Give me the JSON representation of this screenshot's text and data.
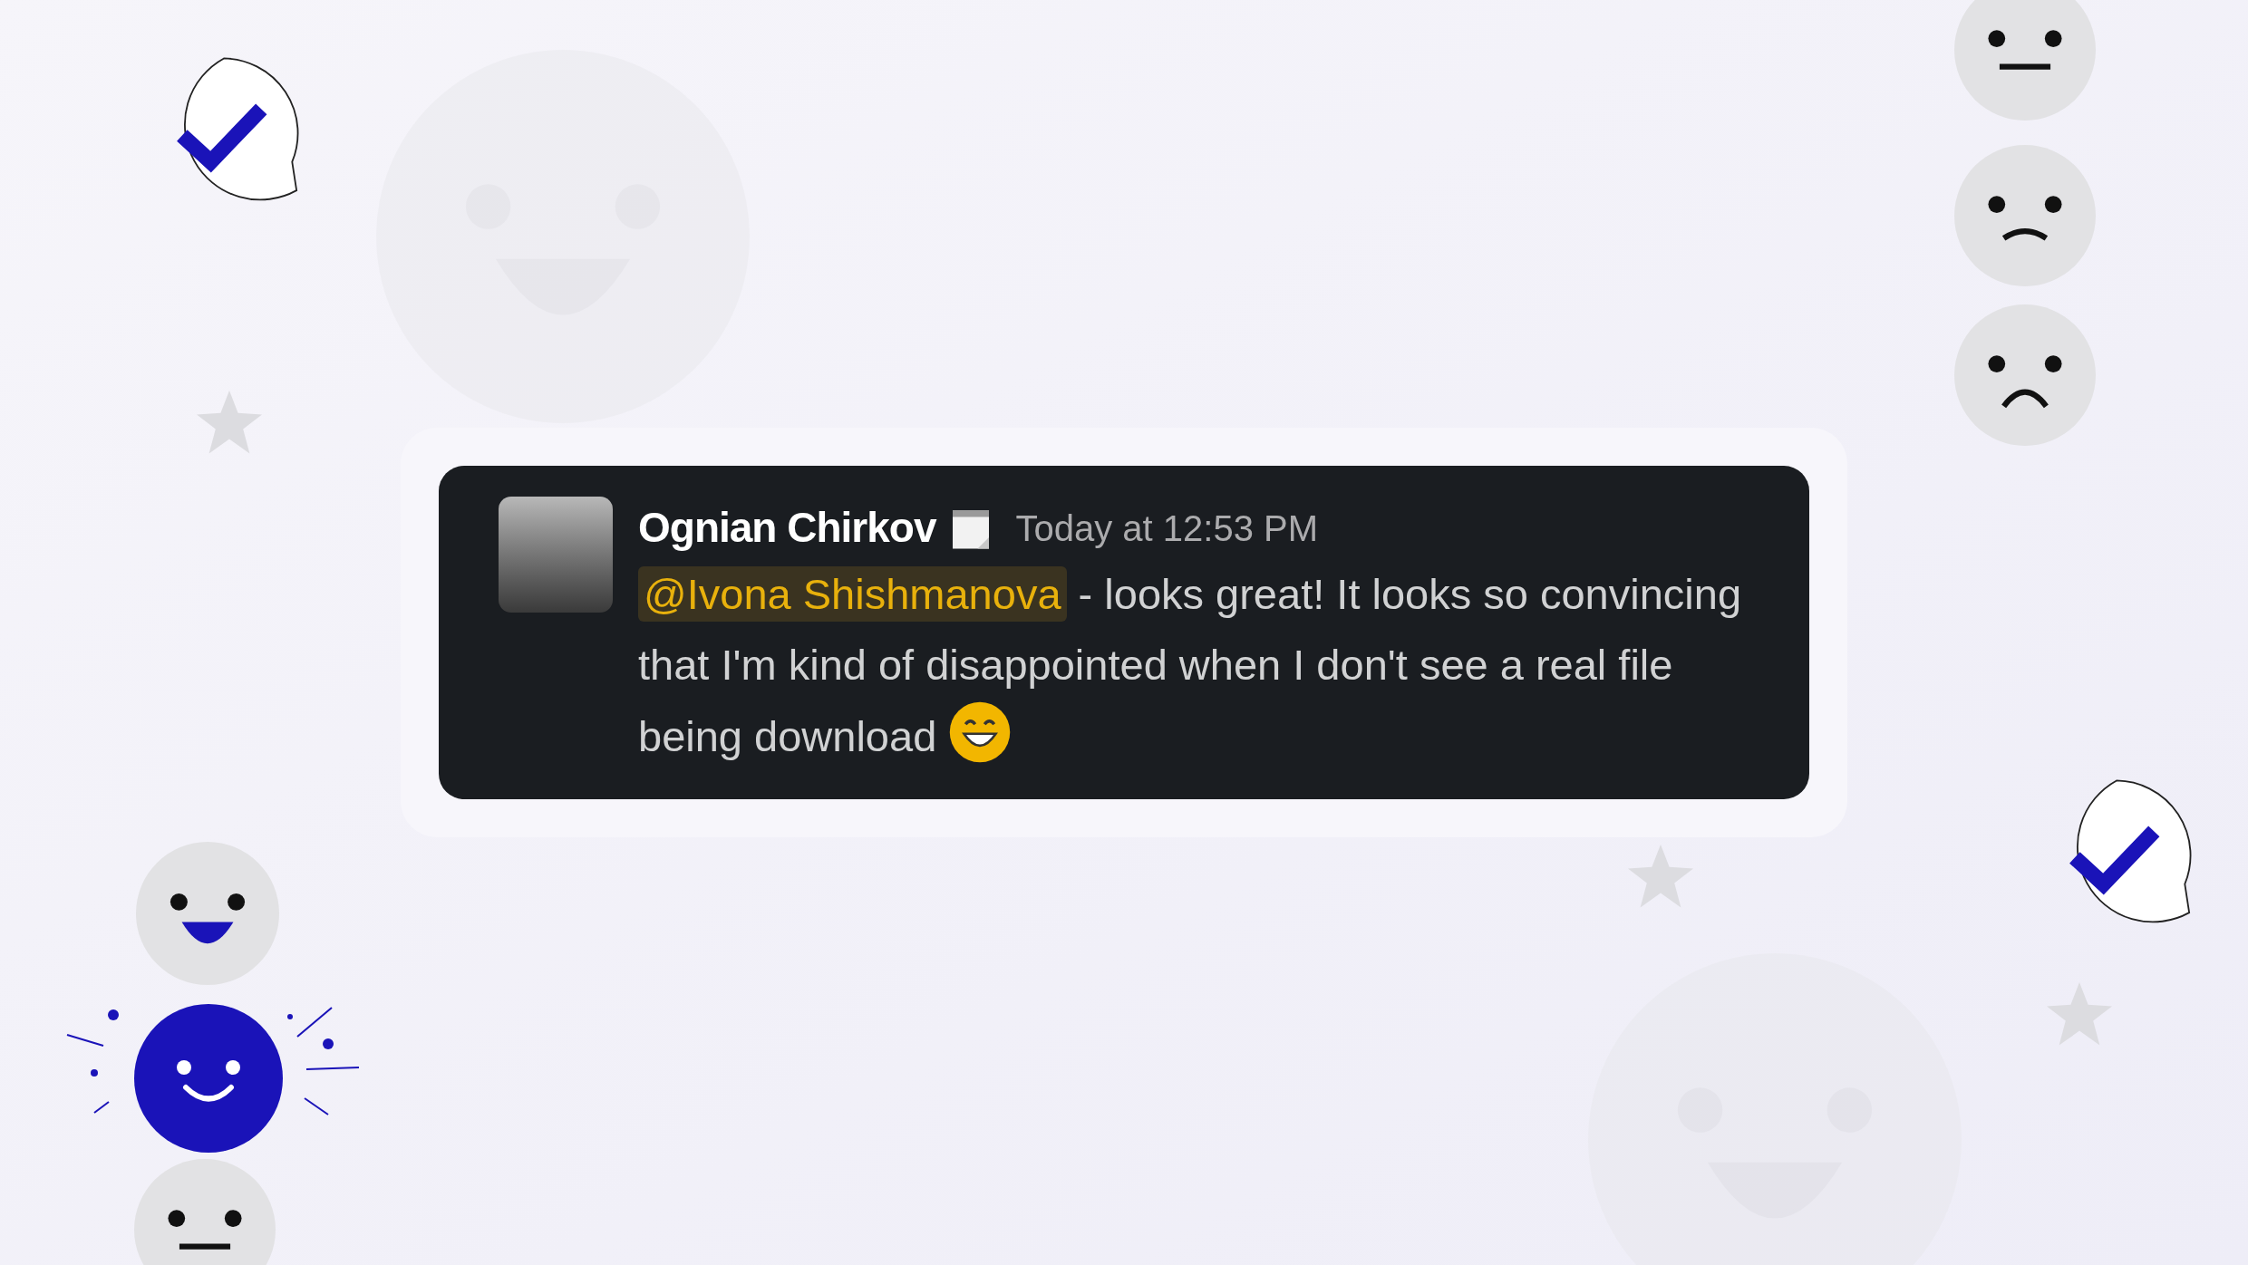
{
  "message": {
    "author": "Ognian Chirkov",
    "time": "Today at 12:53 PM",
    "mention": "@Ivona Shishmanova",
    "text": " - looks great! It looks so convincing that I'm kind of disappointed when I don't see a real file being download"
  }
}
